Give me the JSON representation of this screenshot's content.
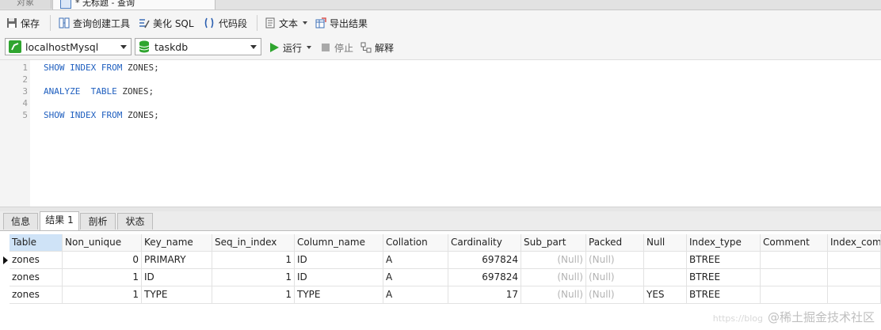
{
  "tabs": {
    "objects": "对象",
    "query": "* 无标题 - 查询"
  },
  "toolbar": {
    "save": "保存",
    "query_builder": "查询创建工具",
    "beautify": "美化 SQL",
    "snippet": "代码段",
    "text": "文本",
    "export": "导出结果"
  },
  "toolbar2": {
    "connection": "localhostMysql",
    "database": "taskdb",
    "run": "运行",
    "stop": "停止",
    "explain": "解释"
  },
  "editor": {
    "lines": [
      {
        "num": "1",
        "kw": "SHOW INDEX FROM",
        "rest": " ZONES;"
      },
      {
        "num": "2",
        "kw": "",
        "rest": ""
      },
      {
        "num": "3",
        "kw": "ANALYZE  TABLE",
        "rest": " ZONES;"
      },
      {
        "num": "4",
        "kw": "",
        "rest": ""
      },
      {
        "num": "5",
        "kw": "SHOW INDEX FROM",
        "rest": " ZONES;"
      }
    ]
  },
  "result_tabs": [
    "信息",
    "结果 1",
    "剖析",
    "状态"
  ],
  "grid": {
    "columns": [
      "Table",
      "Non_unique",
      "Key_name",
      "Seq_in_index",
      "Column_name",
      "Collation",
      "Cardinality",
      "Sub_part",
      "Packed",
      "Null",
      "Index_type",
      "Comment",
      "Index_comm"
    ],
    "rows": [
      [
        "zones",
        "0",
        "PRIMARY",
        "1",
        "ID",
        "A",
        "697824",
        "(Null)",
        "(Null)",
        "",
        "BTREE",
        "",
        ""
      ],
      [
        "zones",
        "1",
        "ID",
        "1",
        "ID",
        "A",
        "697824",
        "(Null)",
        "(Null)",
        "",
        "BTREE",
        "",
        ""
      ],
      [
        "zones",
        "1",
        "TYPE",
        "1",
        "TYPE",
        "A",
        "17",
        "(Null)",
        "(Null)",
        "YES",
        "BTREE",
        "",
        ""
      ]
    ]
  },
  "watermark": {
    "url": "https://blog",
    "text": "@稀土掘金技术社区"
  },
  "colors": {
    "keyword": "#1f5fbf",
    "header_selected": "#cfe3f7",
    "run_green": "#2fa52f",
    "null_gray": "#b3b3b3"
  }
}
